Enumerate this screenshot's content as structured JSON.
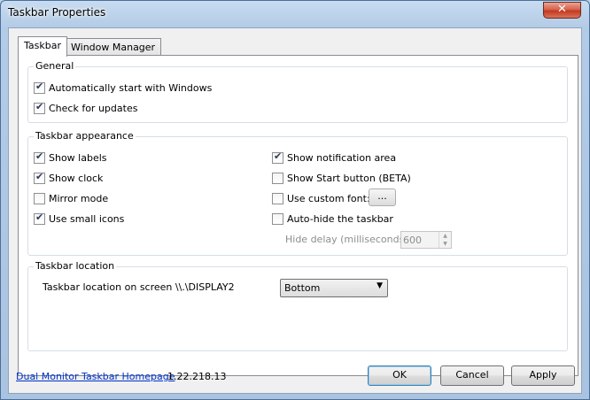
{
  "window": {
    "title": "Taskbar Properties",
    "close_glyph": "✕"
  },
  "tabs": [
    {
      "label": "Taskbar",
      "active": true
    },
    {
      "label": "Window Manager",
      "active": false
    }
  ],
  "general": {
    "label": "General",
    "options": [
      {
        "label": "Automatically start with Windows",
        "checked": true
      },
      {
        "label": "Check for updates",
        "checked": true
      }
    ]
  },
  "appearance": {
    "label": "Taskbar appearance",
    "left": [
      {
        "label": "Show labels",
        "checked": true
      },
      {
        "label": "Show clock",
        "checked": true
      },
      {
        "label": "Mirror mode",
        "checked": false
      },
      {
        "label": "Use small icons",
        "checked": true
      }
    ],
    "right": [
      {
        "label": "Show notification area",
        "checked": true
      },
      {
        "label": "Show Start button (BETA)",
        "checked": false
      },
      {
        "label": "Use custom font:",
        "checked": false
      },
      {
        "label": "Auto-hide the taskbar",
        "checked": false
      }
    ],
    "font_button_label": "...",
    "hide_delay_label": "Hide delay (milliseconds):",
    "hide_delay_value": "600"
  },
  "location": {
    "label": "Taskbar location",
    "screen_label": "Taskbar location on screen \\\\.\\DISPLAY2",
    "selected": "Bottom"
  },
  "footer": {
    "homepage_link": "Dual Monitor Taskbar Homepage",
    "version": "1.22.218.13",
    "ok_label": "OK",
    "cancel_label": "Cancel",
    "apply_label": "Apply"
  }
}
